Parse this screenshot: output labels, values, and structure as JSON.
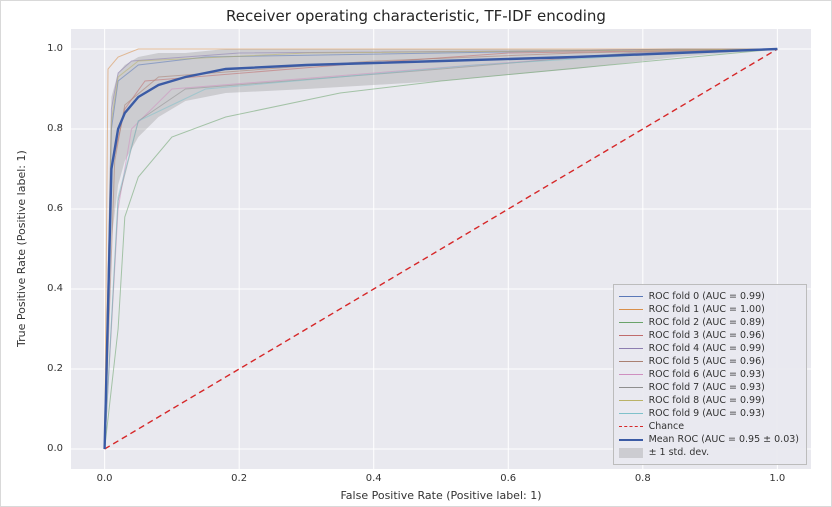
{
  "chart_data": {
    "type": "line",
    "title": "Receiver operating characteristic, TF-IDF encoding",
    "xlabel": "False Positive Rate (Positive label: 1)",
    "ylabel": "True Positive Rate (Positive label: 1)",
    "xlim": [
      -0.05,
      1.05
    ],
    "ylim": [
      -0.05,
      1.05
    ],
    "xticks": [
      0.0,
      0.2,
      0.4,
      0.6,
      0.8,
      1.0
    ],
    "yticks": [
      0.0,
      0.2,
      0.4,
      0.6,
      0.8,
      1.0
    ],
    "grid": true,
    "legend_position": "lower right",
    "series": [
      {
        "name": "ROC fold 0 (AUC = 0.99)",
        "color": "#5a78b8",
        "auc": 0.99,
        "x": [
          0.0,
          0.01,
          0.02,
          0.05,
          0.15,
          0.85,
          1.0
        ],
        "y": [
          0.0,
          0.8,
          0.92,
          0.96,
          0.98,
          1.0,
          1.0
        ]
      },
      {
        "name": "ROC fold 1 (AUC = 1.00)",
        "color": "#d98f4a",
        "auc": 1.0,
        "x": [
          0.0,
          0.005,
          0.02,
          0.05,
          1.0
        ],
        "y": [
          0.0,
          0.95,
          0.98,
          1.0,
          1.0
        ]
      },
      {
        "name": "ROC fold 2 (AUC = 0.89)",
        "color": "#6aa36a",
        "auc": 0.89,
        "x": [
          0.0,
          0.02,
          0.03,
          0.05,
          0.1,
          0.18,
          0.35,
          0.5,
          1.0
        ],
        "y": [
          0.0,
          0.3,
          0.58,
          0.68,
          0.78,
          0.83,
          0.89,
          0.92,
          1.0
        ]
      },
      {
        "name": "ROC fold 3 (AUC = 0.96)",
        "color": "#c06c6c",
        "auc": 0.96,
        "x": [
          0.0,
          0.01,
          0.03,
          0.06,
          0.35,
          0.6,
          1.0
        ],
        "y": [
          0.0,
          0.7,
          0.85,
          0.92,
          0.96,
          0.99,
          1.0
        ]
      },
      {
        "name": "ROC fold 4 (AUC = 0.99)",
        "color": "#8d7eb1",
        "auc": 0.99,
        "x": [
          0.0,
          0.01,
          0.02,
          0.04,
          0.2,
          1.0
        ],
        "y": [
          0.0,
          0.85,
          0.94,
          0.97,
          0.99,
          1.0
        ]
      },
      {
        "name": "ROC fold 5 (AUC = 0.96)",
        "color": "#aa8071",
        "auc": 0.96,
        "x": [
          0.0,
          0.015,
          0.03,
          0.08,
          0.4,
          0.7,
          1.0
        ],
        "y": [
          0.0,
          0.72,
          0.86,
          0.93,
          0.97,
          0.99,
          1.0
        ]
      },
      {
        "name": "ROC fold 6 (AUC = 0.93)",
        "color": "#cf8fc0",
        "auc": 0.93,
        "x": [
          0.0,
          0.02,
          0.04,
          0.1,
          0.55,
          0.8,
          1.0
        ],
        "y": [
          0.0,
          0.6,
          0.8,
          0.9,
          0.96,
          0.99,
          1.0
        ]
      },
      {
        "name": "ROC fold 7 (AUC = 0.93)",
        "color": "#8f8f8f",
        "auc": 0.93,
        "x": [
          0.0,
          0.02,
          0.05,
          0.12,
          0.5,
          0.78,
          1.0
        ],
        "y": [
          0.0,
          0.62,
          0.82,
          0.9,
          0.95,
          0.99,
          1.0
        ]
      },
      {
        "name": "ROC fold 8 (AUC = 0.99)",
        "color": "#bab267",
        "auc": 0.99,
        "x": [
          0.0,
          0.01,
          0.02,
          0.05,
          0.3,
          1.0
        ],
        "y": [
          0.0,
          0.82,
          0.93,
          0.97,
          0.99,
          1.0
        ]
      },
      {
        "name": "ROC fold 9 (AUC = 0.93)",
        "color": "#7fc1ca",
        "auc": 0.93,
        "x": [
          0.0,
          0.02,
          0.05,
          0.15,
          0.55,
          0.85,
          1.0
        ],
        "y": [
          0.0,
          0.63,
          0.82,
          0.9,
          0.96,
          0.99,
          1.0
        ]
      }
    ],
    "chance": {
      "name": "Chance",
      "color": "#d62728",
      "style": "dashed",
      "x": [
        0.0,
        1.0
      ],
      "y": [
        0.0,
        1.0
      ]
    },
    "mean": {
      "name": "Mean ROC (AUC = 0.95 ± 0.03)",
      "color": "#3b5ba5",
      "auc": 0.95,
      "auc_std": 0.03,
      "x": [
        0.0,
        0.01,
        0.02,
        0.03,
        0.05,
        0.08,
        0.12,
        0.18,
        0.3,
        0.5,
        0.7,
        0.85,
        1.0
      ],
      "y": [
        0.0,
        0.7,
        0.8,
        0.84,
        0.88,
        0.91,
        0.93,
        0.95,
        0.96,
        0.97,
        0.98,
        0.99,
        1.0
      ]
    },
    "std_band": {
      "name": "± 1 std. dev.",
      "x": [
        0.0,
        0.01,
        0.02,
        0.03,
        0.05,
        0.08,
        0.12,
        0.18,
        0.3,
        0.5,
        0.7,
        0.85,
        1.0
      ],
      "upper": [
        0.0,
        0.88,
        0.94,
        0.96,
        0.98,
        0.99,
        0.99,
        1.0,
        1.0,
        1.0,
        1.0,
        1.0,
        1.0
      ],
      "lower": [
        0.0,
        0.52,
        0.66,
        0.72,
        0.78,
        0.83,
        0.87,
        0.89,
        0.9,
        0.92,
        0.95,
        0.98,
        1.0
      ]
    }
  },
  "tick_format": {
    "0": "0.0",
    "0.2": "0.2",
    "0.4": "0.4",
    "0.6": "0.6",
    "0.8": "0.8",
    "1": "1.0"
  }
}
